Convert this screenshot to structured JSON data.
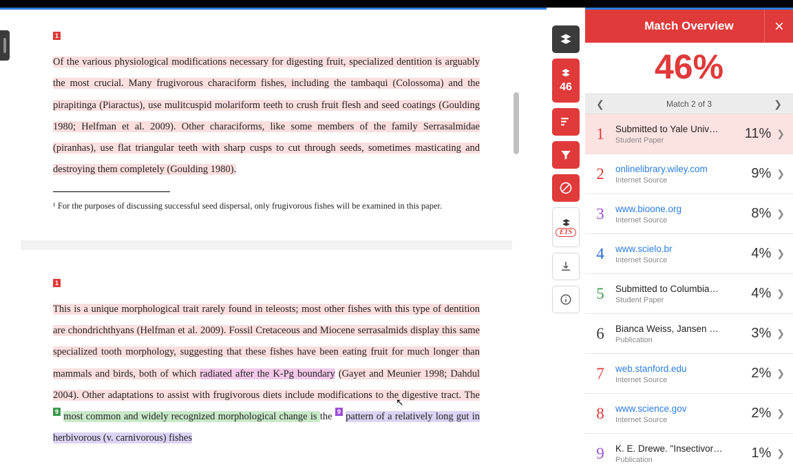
{
  "document": {
    "page1": {
      "marker1": "1",
      "text": "Of the various physiological modifications necessary for digesting fruit, specialized dentition is arguably the most crucial. Many frugivorous characiform fishes, including the tambaqui (Colossoma) and the pirapitinga (Piaractus), use mulitcuspid molariform teeth to crush fruit flesh and seed coatings (Goulding 1980; Helfman et al. 2009). Other characiforms, like some members of the family Serrasalmidae (piranhas), use flat triangular teeth with sharp cusps to cut through seeds, sometimes masticating and destroying them completely (Goulding 1980).",
      "footnote": "¹ For the purposes of discussing successful seed dispersal, only frugivorous fishes will be examined in this paper."
    },
    "page2": {
      "marker1": "1",
      "seg1": "This is a unique morphological trait rarely found in teleosts; most other fishes with this type of dentition are chondrichthyans (Helfman et al. 2009). Fossil Cretaceous and Miocene serrasalmids display this same specialized tooth morphology, suggesting that these fishes have been eating fruit for much longer than mammals and birds, both of which ",
      "seg2": "radiated after the K-Pg boundary",
      "seg3": " (Gayet and Meunier 1998; Dahdul 2004). Other adaptations to assist with frugivorous diets include modifications to the digestive tract. The ",
      "marker9a": "9",
      "seg4": "most common and widely recognized morphological change is ",
      "seg5": "the ",
      "marker9b": "9",
      "seg6": "pattern of a relatively long gut in herbivorous (v. carnivorous) fishes"
    }
  },
  "toolbar": {
    "score": "46"
  },
  "matchPanel": {
    "title": "Match Overview",
    "overallPercent": "46%",
    "nav": "Match 2 of 3",
    "sources": [
      {
        "num": "1",
        "title": "Submitted to Yale Univ…",
        "sub": "Student Paper",
        "pct": "11%",
        "link": false,
        "active": true,
        "cls": "n1"
      },
      {
        "num": "2",
        "title": "onlinelibrary.wiley.com",
        "sub": "Internet Source",
        "pct": "9%",
        "link": true,
        "active": false,
        "cls": "n2"
      },
      {
        "num": "3",
        "title": "www.bioone.org",
        "sub": "Internet Source",
        "pct": "8%",
        "link": true,
        "active": false,
        "cls": "n3"
      },
      {
        "num": "4",
        "title": "www.scielo.br",
        "sub": "Internet Source",
        "pct": "4%",
        "link": true,
        "active": false,
        "cls": "n4"
      },
      {
        "num": "5",
        "title": "Submitted to Columbia…",
        "sub": "Student Paper",
        "pct": "4%",
        "link": false,
        "active": false,
        "cls": "n5"
      },
      {
        "num": "6",
        "title": "Bianca Weiss, Jansen …",
        "sub": "Publication",
        "pct": "3%",
        "link": false,
        "active": false,
        "cls": "n6"
      },
      {
        "num": "7",
        "title": "web.stanford.edu",
        "sub": "Internet Source",
        "pct": "2%",
        "link": true,
        "active": false,
        "cls": "n7"
      },
      {
        "num": "8",
        "title": "www.science.gov",
        "sub": "Internet Source",
        "pct": "2%",
        "link": true,
        "active": false,
        "cls": "n8"
      },
      {
        "num": "9",
        "title": "K. E. Drewe. \"Insectivor…",
        "sub": "Publication",
        "pct": "1%",
        "link": false,
        "active": false,
        "cls": "n9"
      }
    ]
  }
}
